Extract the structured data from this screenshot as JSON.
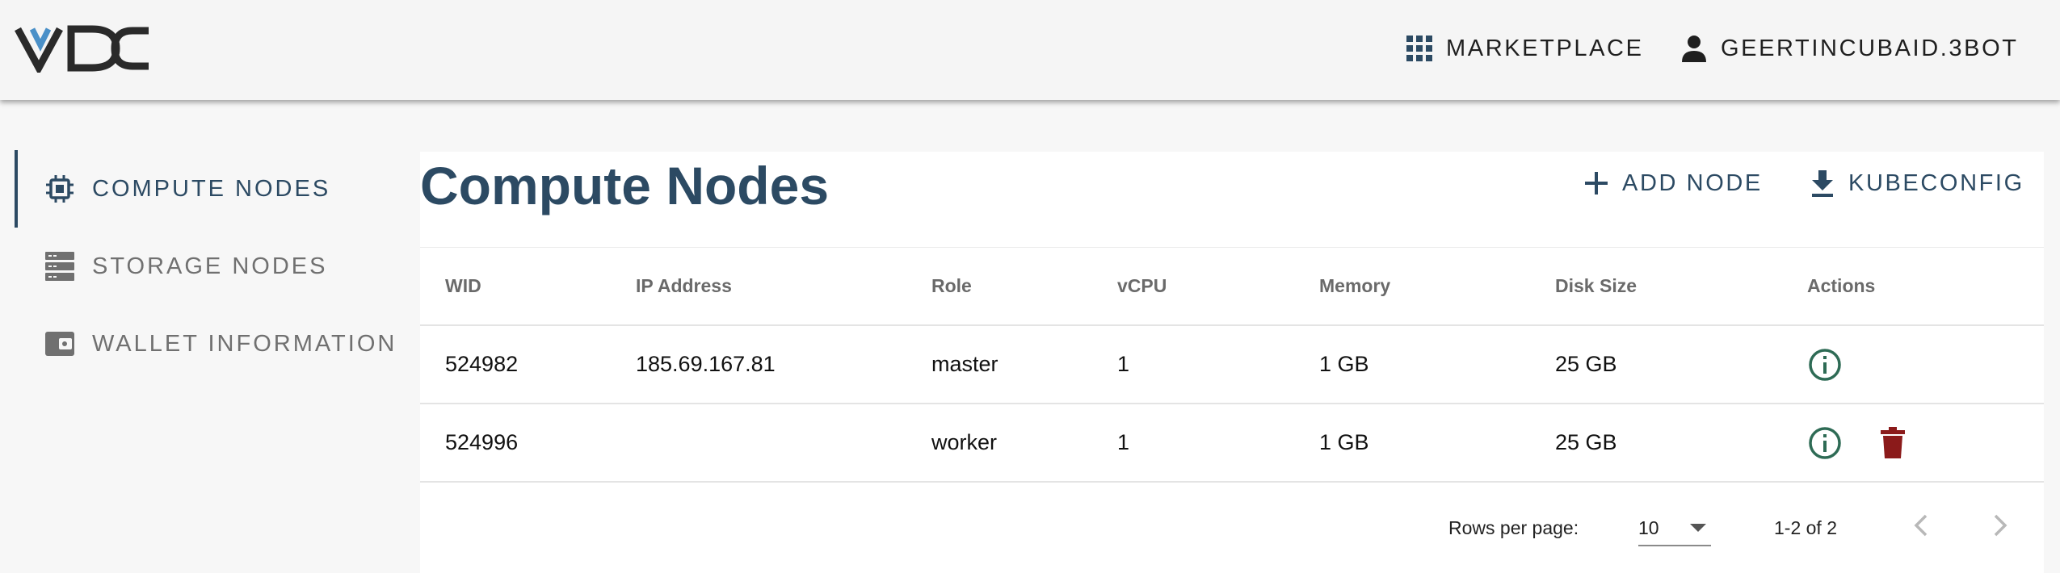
{
  "header": {
    "logo_text": "VDC",
    "marketplace_label": "MARKETPLACE",
    "user_label": "GEERTINCUBAID.3BOT"
  },
  "sidebar": {
    "items": [
      {
        "label": "COMPUTE NODES",
        "icon": "chip-icon",
        "active": true
      },
      {
        "label": "STORAGE NODES",
        "icon": "storage-icon",
        "active": false
      },
      {
        "label": "WALLET INFORMATION",
        "icon": "wallet-icon",
        "active": false
      }
    ]
  },
  "main": {
    "title": "Compute Nodes",
    "add_node_label": "ADD NODE",
    "kubeconfig_label": "KUBECONFIG",
    "table": {
      "columns": [
        "WID",
        "IP Address",
        "Role",
        "vCPU",
        "Memory",
        "Disk Size",
        "Actions"
      ],
      "rows": [
        {
          "wid": "524982",
          "ip": "185.69.167.81",
          "role": "master",
          "vcpu": "1",
          "memory": "1 GB",
          "disk": "25 GB",
          "actions": [
            "info-icon"
          ]
        },
        {
          "wid": "524996",
          "ip": "",
          "role": "worker",
          "vcpu": "1",
          "memory": "1 GB",
          "disk": "25 GB",
          "actions": [
            "info-icon",
            "delete-icon"
          ]
        }
      ]
    },
    "pagination": {
      "rows_per_page_label": "Rows per page:",
      "rows_per_page_value": "10",
      "range_text": "1-2 of 2"
    }
  },
  "colors": {
    "primary": "#2c4a63",
    "info_icon": "#2e6b55",
    "delete_icon": "#8b1a1a",
    "logo_blue": "#4a90c8"
  }
}
